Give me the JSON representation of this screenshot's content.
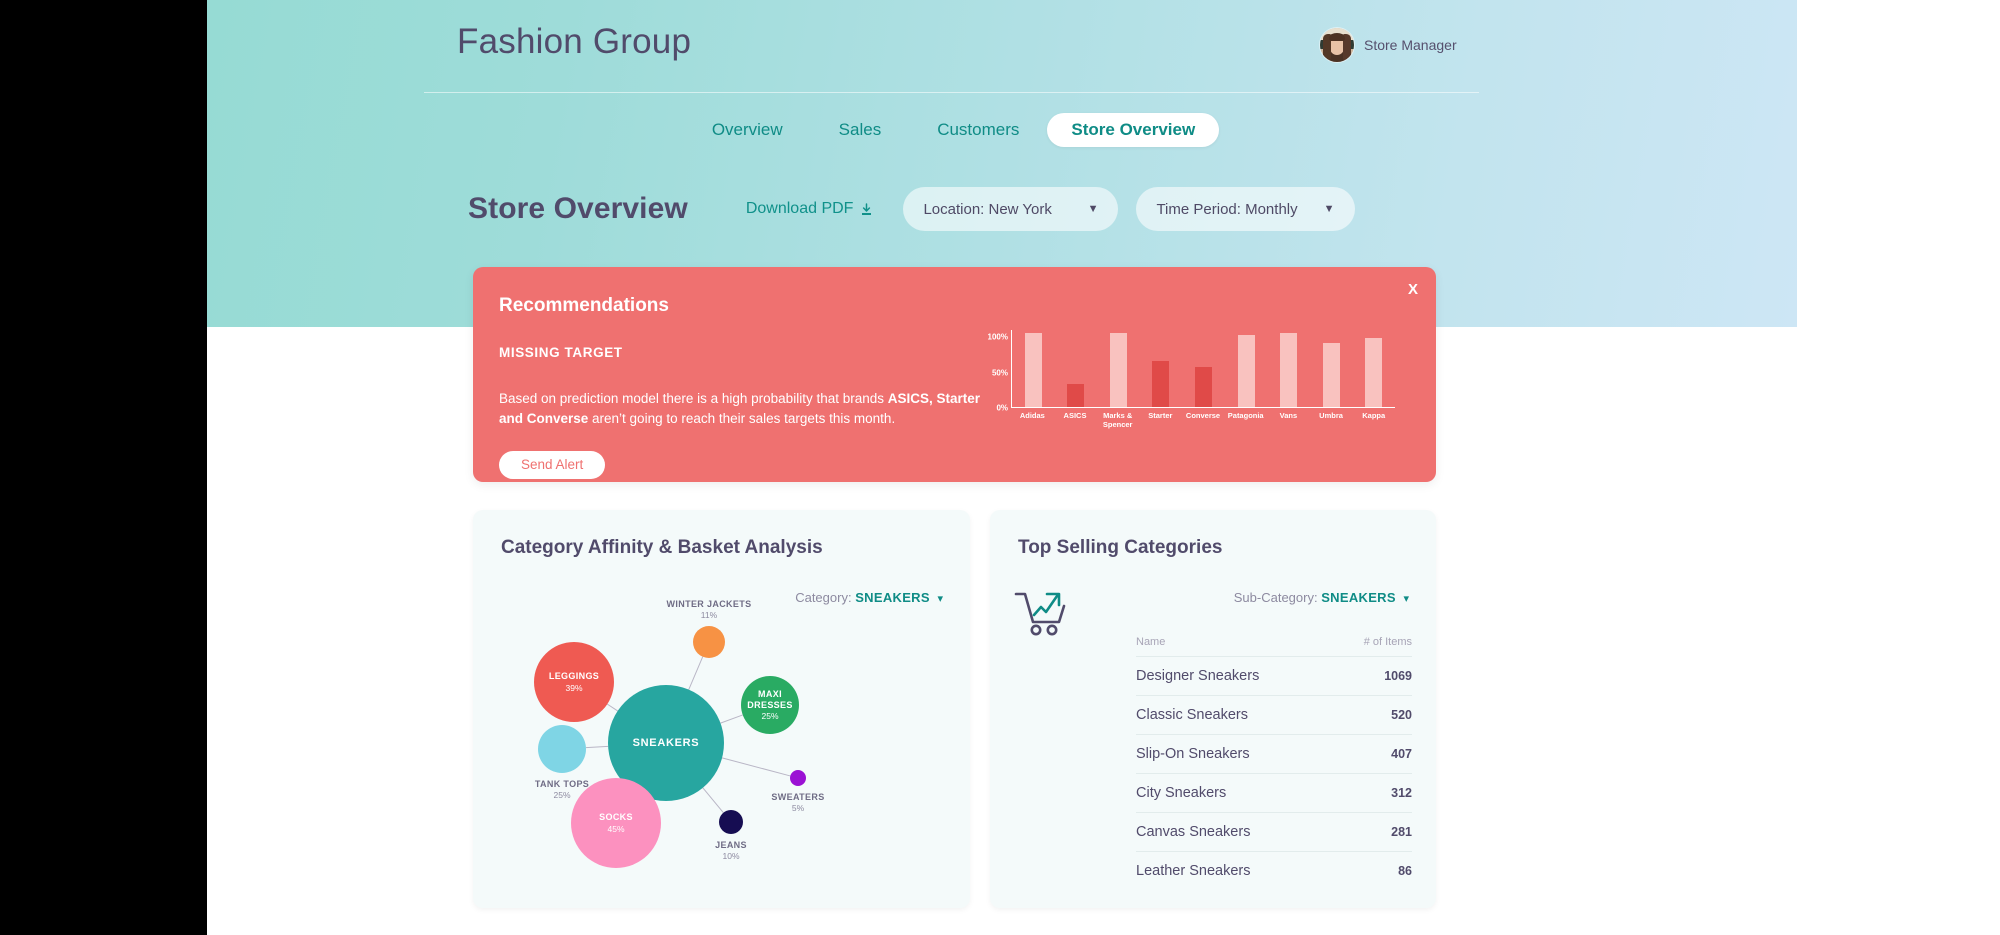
{
  "brand": {
    "title": "Fashion Group"
  },
  "user": {
    "name": "Store Manager",
    "avatar_icon": "user-avatar-photo"
  },
  "nav": {
    "items": [
      {
        "label": "Overview",
        "active": false
      },
      {
        "label": "Sales",
        "active": false
      },
      {
        "label": "Customers",
        "active": false
      },
      {
        "label": "Store Overview",
        "active": true
      }
    ]
  },
  "page": {
    "title": "Store Overview",
    "download_label": "Download PDF",
    "download_icon": "download-icon",
    "filters": [
      {
        "label": "Location: New York",
        "caret_icon": "chevron-down-icon"
      },
      {
        "label": "Time Period: Monthly",
        "caret_icon": "chevron-down-icon"
      }
    ]
  },
  "recommendations": {
    "title": "Recommendations",
    "subtitle": "MISSING TARGET",
    "body_before": "Based on prediction model there is a high probability that brands ",
    "body_bold": "ASICS, Starter and Converse",
    "body_after": " aren’t going to reach their sales targets this month.",
    "button_label": "Send Alert",
    "close_label": "X",
    "close_icon": "close-icon",
    "accent_color": "#ef7170",
    "bar_normal_color": "#f9c2bf",
    "bar_alert_color": "#e04a48"
  },
  "chart_data": [
    {
      "type": "bar",
      "title": "",
      "xlabel": "",
      "ylabel": "",
      "ylim": [
        0,
        110
      ],
      "yticks": [
        "0%",
        "50%",
        "100%"
      ],
      "ytick_values": [
        0,
        50,
        100
      ],
      "grid": false,
      "legend": "none",
      "categories": [
        "Adidas",
        "ASICS",
        "Marks & Spencer",
        "Starter",
        "Converse",
        "Patagonia",
        "Vans",
        "Umbra",
        "Kappa"
      ],
      "values": [
        104,
        33,
        105,
        65,
        56,
        101,
        105,
        90,
        97
      ],
      "alert_flags": [
        false,
        true,
        false,
        true,
        true,
        false,
        false,
        false,
        false
      ]
    },
    {
      "type": "network",
      "title": "Category Affinity & Basket Analysis",
      "center": {
        "label": "SNEAKERS",
        "color": "#27a6a0",
        "radius": 58
      },
      "nodes": [
        {
          "label": "LEGGINGS",
          "percent": "39%",
          "color": "#ef5a52",
          "radius": 40,
          "label_inside": true
        },
        {
          "label": "WINTER JACKETS",
          "percent": "11%",
          "color": "#f79244",
          "radius": 16,
          "label_inside": false
        },
        {
          "label": "MAXI DRESSES",
          "percent": "25%",
          "color": "#29ab63",
          "radius": 29,
          "label_inside": true
        },
        {
          "label": "SWEATERS",
          "percent": "5%",
          "color": "#9b11d4",
          "radius": 8,
          "label_inside": false
        },
        {
          "label": "JEANS",
          "percent": "10%",
          "color": "#160d52",
          "radius": 12,
          "label_inside": false
        },
        {
          "label": "SOCKS",
          "percent": "45%",
          "color": "#fc91bf",
          "radius": 45,
          "label_inside": true
        },
        {
          "label": "TANK TOPS",
          "percent": "25%",
          "color": "#7fd5e5",
          "radius": 24,
          "label_inside": false
        }
      ]
    }
  ],
  "affinity_panel": {
    "title": "Category Affinity & Basket Analysis",
    "select_label": "Category:",
    "select_value": "SNEAKERS",
    "chevron_icon": "chevron-down-icon"
  },
  "top_selling": {
    "title": "Top Selling Categories",
    "icon": "shopping-cart-trending-up-icon",
    "select_label": "Sub-Category:",
    "select_value": "SNEAKERS",
    "chevron_icon": "chevron-down-icon",
    "columns": [
      "Name",
      "# of Items"
    ],
    "rows": [
      {
        "name": "Designer Sneakers",
        "count": "1069"
      },
      {
        "name": "Classic Sneakers",
        "count": "520"
      },
      {
        "name": "Slip-On Sneakers",
        "count": "407"
      },
      {
        "name": "City Sneakers",
        "count": "312"
      },
      {
        "name": "Canvas Sneakers",
        "count": "281"
      },
      {
        "name": "Leather Sneakers",
        "count": "86"
      }
    ]
  }
}
